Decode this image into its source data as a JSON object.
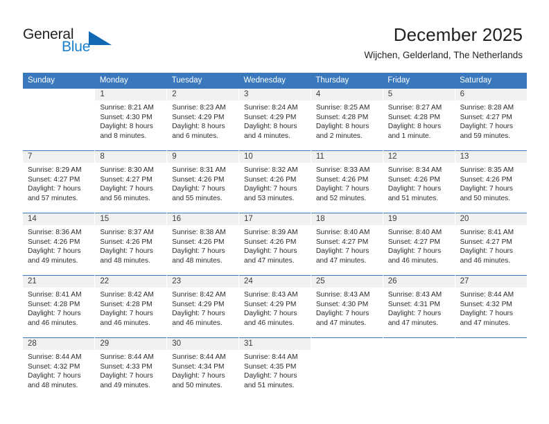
{
  "brand": {
    "name_top": "General",
    "name_bottom": "Blue",
    "triangle_color": "#1268b3",
    "blue_text_color": "#1b7fcc"
  },
  "header": {
    "month_title": "December 2025",
    "location": "Wijchen, Gelderland, The Netherlands"
  },
  "calendar": {
    "header_bg": "#3a78bd",
    "weekday_headers": [
      "Sunday",
      "Monday",
      "Tuesday",
      "Wednesday",
      "Thursday",
      "Friday",
      "Saturday"
    ],
    "weeks": [
      [
        {
          "day": "",
          "sunrise": "",
          "sunset": "",
          "daylight_line1": "",
          "daylight_line2": ""
        },
        {
          "day": "1",
          "sunrise": "Sunrise: 8:21 AM",
          "sunset": "Sunset: 4:30 PM",
          "daylight_line1": "Daylight: 8 hours",
          "daylight_line2": "and 8 minutes."
        },
        {
          "day": "2",
          "sunrise": "Sunrise: 8:23 AM",
          "sunset": "Sunset: 4:29 PM",
          "daylight_line1": "Daylight: 8 hours",
          "daylight_line2": "and 6 minutes."
        },
        {
          "day": "3",
          "sunrise": "Sunrise: 8:24 AM",
          "sunset": "Sunset: 4:29 PM",
          "daylight_line1": "Daylight: 8 hours",
          "daylight_line2": "and 4 minutes."
        },
        {
          "day": "4",
          "sunrise": "Sunrise: 8:25 AM",
          "sunset": "Sunset: 4:28 PM",
          "daylight_line1": "Daylight: 8 hours",
          "daylight_line2": "and 2 minutes."
        },
        {
          "day": "5",
          "sunrise": "Sunrise: 8:27 AM",
          "sunset": "Sunset: 4:28 PM",
          "daylight_line1": "Daylight: 8 hours",
          "daylight_line2": "and 1 minute."
        },
        {
          "day": "6",
          "sunrise": "Sunrise: 8:28 AM",
          "sunset": "Sunset: 4:27 PM",
          "daylight_line1": "Daylight: 7 hours",
          "daylight_line2": "and 59 minutes."
        }
      ],
      [
        {
          "day": "7",
          "sunrise": "Sunrise: 8:29 AM",
          "sunset": "Sunset: 4:27 PM",
          "daylight_line1": "Daylight: 7 hours",
          "daylight_line2": "and 57 minutes."
        },
        {
          "day": "8",
          "sunrise": "Sunrise: 8:30 AM",
          "sunset": "Sunset: 4:27 PM",
          "daylight_line1": "Daylight: 7 hours",
          "daylight_line2": "and 56 minutes."
        },
        {
          "day": "9",
          "sunrise": "Sunrise: 8:31 AM",
          "sunset": "Sunset: 4:26 PM",
          "daylight_line1": "Daylight: 7 hours",
          "daylight_line2": "and 55 minutes."
        },
        {
          "day": "10",
          "sunrise": "Sunrise: 8:32 AM",
          "sunset": "Sunset: 4:26 PM",
          "daylight_line1": "Daylight: 7 hours",
          "daylight_line2": "and 53 minutes."
        },
        {
          "day": "11",
          "sunrise": "Sunrise: 8:33 AM",
          "sunset": "Sunset: 4:26 PM",
          "daylight_line1": "Daylight: 7 hours",
          "daylight_line2": "and 52 minutes."
        },
        {
          "day": "12",
          "sunrise": "Sunrise: 8:34 AM",
          "sunset": "Sunset: 4:26 PM",
          "daylight_line1": "Daylight: 7 hours",
          "daylight_line2": "and 51 minutes."
        },
        {
          "day": "13",
          "sunrise": "Sunrise: 8:35 AM",
          "sunset": "Sunset: 4:26 PM",
          "daylight_line1": "Daylight: 7 hours",
          "daylight_line2": "and 50 minutes."
        }
      ],
      [
        {
          "day": "14",
          "sunrise": "Sunrise: 8:36 AM",
          "sunset": "Sunset: 4:26 PM",
          "daylight_line1": "Daylight: 7 hours",
          "daylight_line2": "and 49 minutes."
        },
        {
          "day": "15",
          "sunrise": "Sunrise: 8:37 AM",
          "sunset": "Sunset: 4:26 PM",
          "daylight_line1": "Daylight: 7 hours",
          "daylight_line2": "and 48 minutes."
        },
        {
          "day": "16",
          "sunrise": "Sunrise: 8:38 AM",
          "sunset": "Sunset: 4:26 PM",
          "daylight_line1": "Daylight: 7 hours",
          "daylight_line2": "and 48 minutes."
        },
        {
          "day": "17",
          "sunrise": "Sunrise: 8:39 AM",
          "sunset": "Sunset: 4:26 PM",
          "daylight_line1": "Daylight: 7 hours",
          "daylight_line2": "and 47 minutes."
        },
        {
          "day": "18",
          "sunrise": "Sunrise: 8:40 AM",
          "sunset": "Sunset: 4:27 PM",
          "daylight_line1": "Daylight: 7 hours",
          "daylight_line2": "and 47 minutes."
        },
        {
          "day": "19",
          "sunrise": "Sunrise: 8:40 AM",
          "sunset": "Sunset: 4:27 PM",
          "daylight_line1": "Daylight: 7 hours",
          "daylight_line2": "and 46 minutes."
        },
        {
          "day": "20",
          "sunrise": "Sunrise: 8:41 AM",
          "sunset": "Sunset: 4:27 PM",
          "daylight_line1": "Daylight: 7 hours",
          "daylight_line2": "and 46 minutes."
        }
      ],
      [
        {
          "day": "21",
          "sunrise": "Sunrise: 8:41 AM",
          "sunset": "Sunset: 4:28 PM",
          "daylight_line1": "Daylight: 7 hours",
          "daylight_line2": "and 46 minutes."
        },
        {
          "day": "22",
          "sunrise": "Sunrise: 8:42 AM",
          "sunset": "Sunset: 4:28 PM",
          "daylight_line1": "Daylight: 7 hours",
          "daylight_line2": "and 46 minutes."
        },
        {
          "day": "23",
          "sunrise": "Sunrise: 8:42 AM",
          "sunset": "Sunset: 4:29 PM",
          "daylight_line1": "Daylight: 7 hours",
          "daylight_line2": "and 46 minutes."
        },
        {
          "day": "24",
          "sunrise": "Sunrise: 8:43 AM",
          "sunset": "Sunset: 4:29 PM",
          "daylight_line1": "Daylight: 7 hours",
          "daylight_line2": "and 46 minutes."
        },
        {
          "day": "25",
          "sunrise": "Sunrise: 8:43 AM",
          "sunset": "Sunset: 4:30 PM",
          "daylight_line1": "Daylight: 7 hours",
          "daylight_line2": "and 47 minutes."
        },
        {
          "day": "26",
          "sunrise": "Sunrise: 8:43 AM",
          "sunset": "Sunset: 4:31 PM",
          "daylight_line1": "Daylight: 7 hours",
          "daylight_line2": "and 47 minutes."
        },
        {
          "day": "27",
          "sunrise": "Sunrise: 8:44 AM",
          "sunset": "Sunset: 4:32 PM",
          "daylight_line1": "Daylight: 7 hours",
          "daylight_line2": "and 47 minutes."
        }
      ],
      [
        {
          "day": "28",
          "sunrise": "Sunrise: 8:44 AM",
          "sunset": "Sunset: 4:32 PM",
          "daylight_line1": "Daylight: 7 hours",
          "daylight_line2": "and 48 minutes."
        },
        {
          "day": "29",
          "sunrise": "Sunrise: 8:44 AM",
          "sunset": "Sunset: 4:33 PM",
          "daylight_line1": "Daylight: 7 hours",
          "daylight_line2": "and 49 minutes."
        },
        {
          "day": "30",
          "sunrise": "Sunrise: 8:44 AM",
          "sunset": "Sunset: 4:34 PM",
          "daylight_line1": "Daylight: 7 hours",
          "daylight_line2": "and 50 minutes."
        },
        {
          "day": "31",
          "sunrise": "Sunrise: 8:44 AM",
          "sunset": "Sunset: 4:35 PM",
          "daylight_line1": "Daylight: 7 hours",
          "daylight_line2": "and 51 minutes."
        },
        {
          "day": "",
          "sunrise": "",
          "sunset": "",
          "daylight_line1": "",
          "daylight_line2": ""
        },
        {
          "day": "",
          "sunrise": "",
          "sunset": "",
          "daylight_line1": "",
          "daylight_line2": ""
        },
        {
          "day": "",
          "sunrise": "",
          "sunset": "",
          "daylight_line1": "",
          "daylight_line2": ""
        }
      ]
    ]
  }
}
